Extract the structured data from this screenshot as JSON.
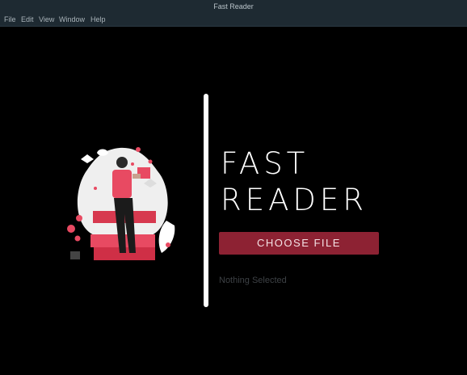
{
  "window": {
    "title": "Fast Reader"
  },
  "menu": {
    "items": [
      {
        "label": "File"
      },
      {
        "label": "Edit"
      },
      {
        "label": "View"
      },
      {
        "label": "Window"
      },
      {
        "label": "Help"
      }
    ]
  },
  "hero": {
    "title_line1": "FAST",
    "title_line2": "READER",
    "button_label": "CHOOSE FILE",
    "status_text": "Nothing Selected"
  },
  "colors": {
    "background": "#000000",
    "titlebar": "#1e2a32",
    "button": "#8d2233",
    "accent_red": "#e84a62",
    "text": "#ffffff"
  },
  "illustration": {
    "icon": "person-reading-book-on-stack-illustration"
  }
}
